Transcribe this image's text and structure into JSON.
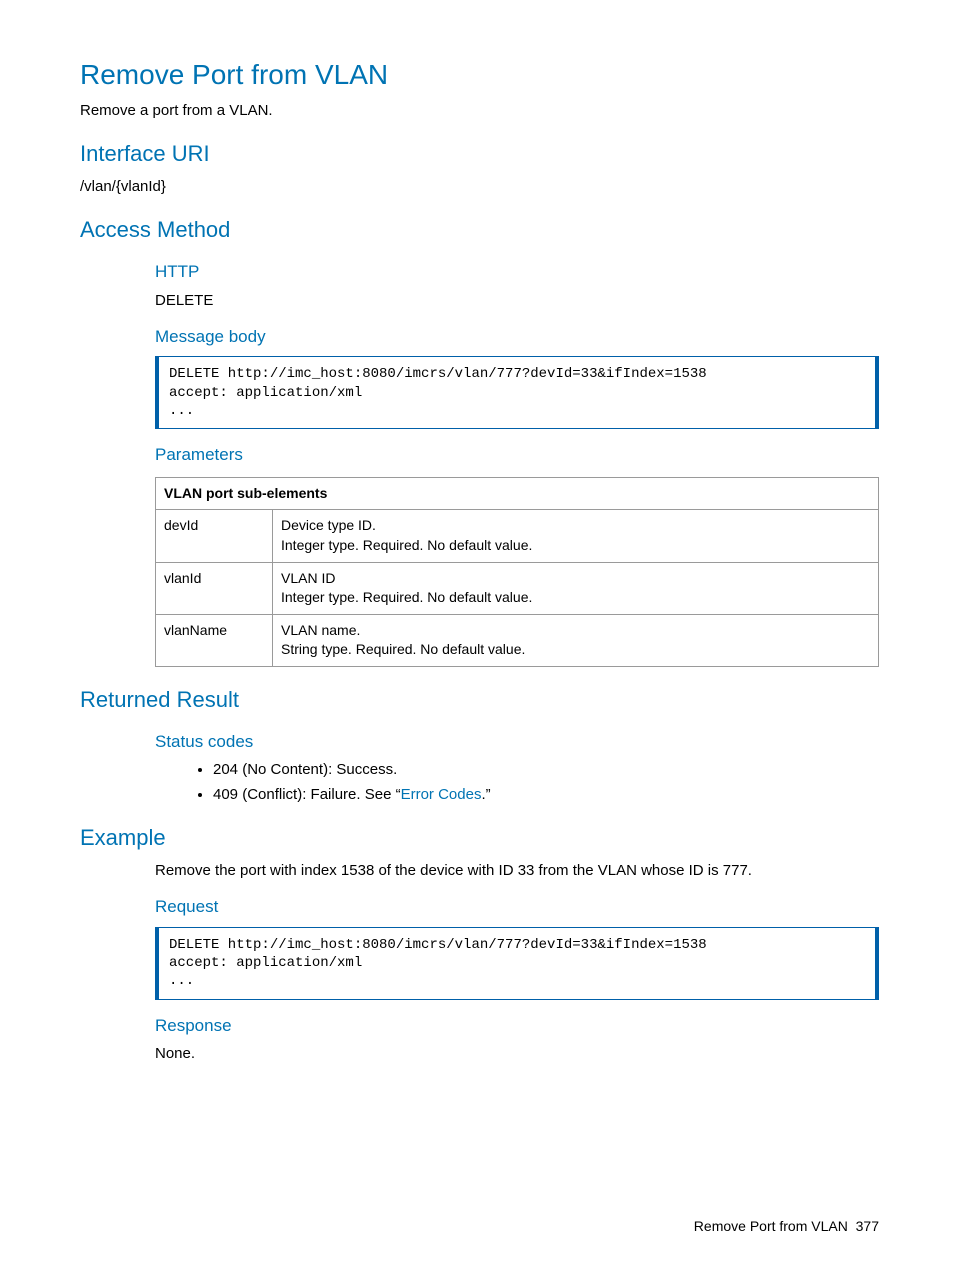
{
  "page": {
    "title": "Remove Port from VLAN",
    "desc": "Remove a port from a VLAN."
  },
  "interface": {
    "heading": "Interface URI",
    "uri": "/vlan/{vlanId}"
  },
  "access": {
    "heading": "Access Method",
    "http_heading": "HTTP",
    "http_method": "DELETE",
    "msgbody_heading": "Message body",
    "msgbody_code": "DELETE http://imc_host:8080/imcrs/vlan/777?devId=33&ifIndex=1538\naccept: application/xml\n...",
    "params_heading": "Parameters",
    "params_table_header": "VLAN port sub-elements",
    "params_rows": [
      {
        "name": "devId",
        "line1": "Device type ID.",
        "line2": "Integer type. Required. No default value."
      },
      {
        "name": "vlanId",
        "line1": "VLAN ID",
        "line2": "Integer type. Required. No default value."
      },
      {
        "name": "vlanName",
        "line1": "VLAN name.",
        "line2": "String type. Required. No default value."
      }
    ]
  },
  "result": {
    "heading": "Returned Result",
    "status_heading": "Status codes",
    "status_204": "204 (No Content): Success.",
    "status_409_prefix": "409 (Conflict): Failure. See “",
    "status_409_link": "Error Codes",
    "status_409_suffix": ".”"
  },
  "example": {
    "heading": "Example",
    "desc": "Remove the port with index 1538 of the device with ID 33 from the VLAN whose ID is 777.",
    "request_heading": "Request",
    "request_code": "DELETE http://imc_host:8080/imcrs/vlan/777?devId=33&ifIndex=1538\naccept: application/xml\n...",
    "response_heading": "Response",
    "response_text": "None."
  },
  "footer": {
    "label": "Remove Port from VLAN",
    "page_number": "377"
  }
}
